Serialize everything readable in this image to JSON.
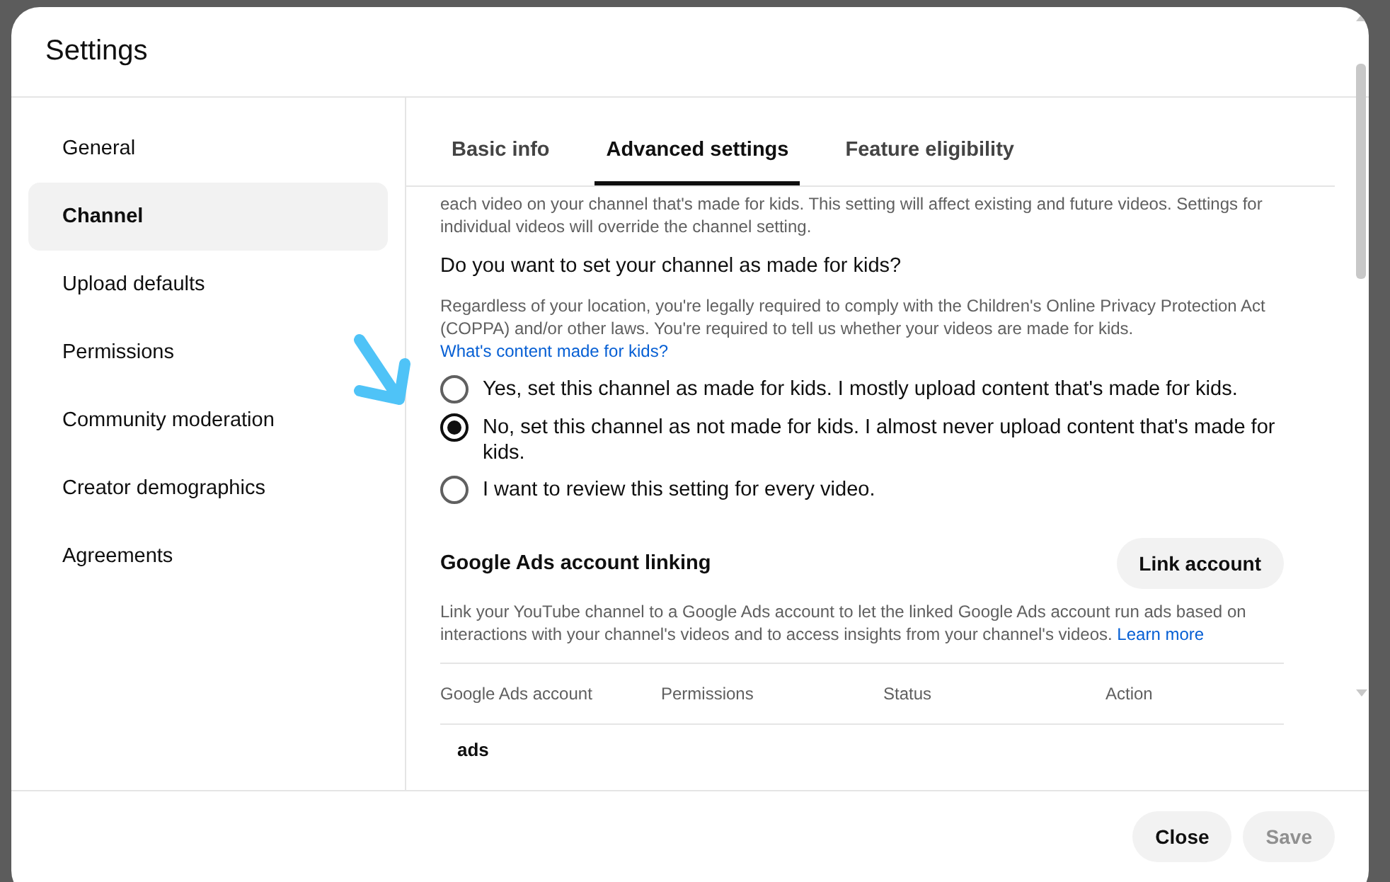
{
  "dialog": {
    "title": "Settings"
  },
  "sidebar": {
    "items": [
      {
        "label": "General",
        "selected": false
      },
      {
        "label": "Channel",
        "selected": true
      },
      {
        "label": "Upload defaults",
        "selected": false
      },
      {
        "label": "Permissions",
        "selected": false
      },
      {
        "label": "Community moderation",
        "selected": false
      },
      {
        "label": "Creator demographics",
        "selected": false
      },
      {
        "label": "Agreements",
        "selected": false
      }
    ]
  },
  "tabs": [
    {
      "label": "Basic info",
      "selected": false
    },
    {
      "label": "Advanced settings",
      "selected": true
    },
    {
      "label": "Feature eligibility",
      "selected": false
    }
  ],
  "audience": {
    "intro": "each video on your channel that's made for kids. This setting will affect existing and future videos. Settings for individual videos will override the channel setting.",
    "question": "Do you want to set your channel as made for kids?",
    "note": "Regardless of your location, you're legally required to comply with the Children's Online Privacy Protection Act (COPPA) and/or other laws. You're required to tell us whether your videos are made for kids.",
    "note_link": "What's content made for kids?",
    "options": [
      {
        "label": "Yes, set this channel as made for kids. I mostly upload content that's made for kids.",
        "selected": false
      },
      {
        "label": "No, set this channel as not made for kids. I almost never upload content that's made for kids.",
        "selected": true
      },
      {
        "label": "I want to review this setting for every video.",
        "selected": false
      }
    ]
  },
  "ads": {
    "title": "Google Ads account linking",
    "button": "Link account",
    "description": "Link your YouTube channel to a Google Ads account to let the linked Google Ads account run ads based on interactions with your channel's videos and to access insights from your channel's videos.",
    "link": "Learn more",
    "columns": [
      "Google Ads account",
      "Permissions",
      "Status",
      "Action"
    ],
    "rows": [
      {
        "cells": [
          "ads"
        ]
      }
    ]
  },
  "footer": {
    "buttons": [
      {
        "label": "Close",
        "disabled": false
      },
      {
        "label": "Save",
        "disabled": true
      }
    ]
  }
}
